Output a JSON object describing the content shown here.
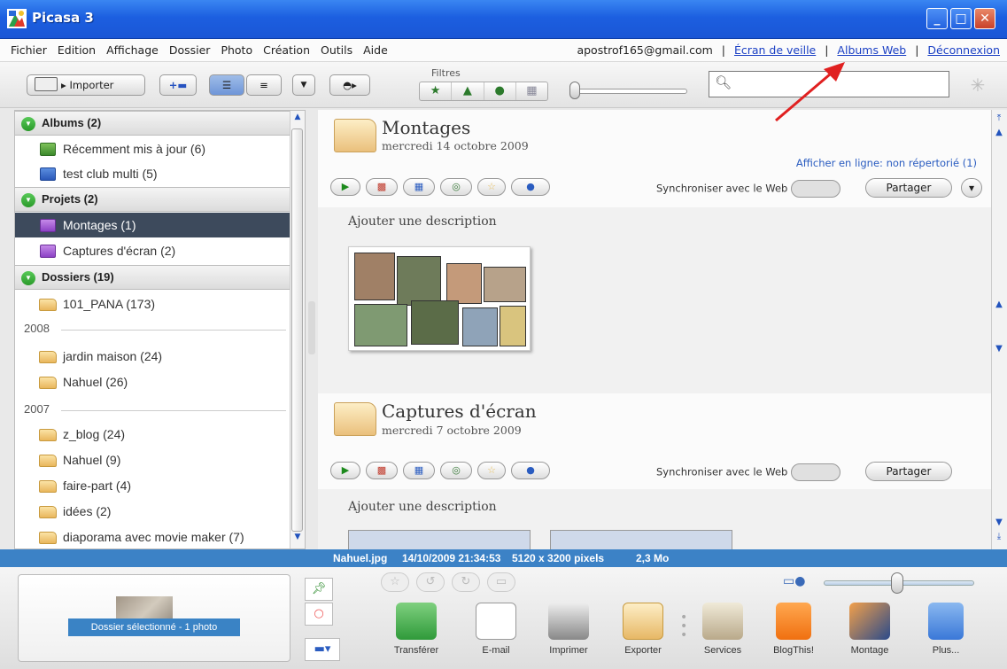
{
  "window": {
    "title": "Picasa 3",
    "controls": {
      "minimize": "_",
      "maximize": "□",
      "close": "✕"
    }
  },
  "menu": {
    "items": [
      "Fichier",
      "Edition",
      "Affichage",
      "Dossier",
      "Photo",
      "Création",
      "Outils",
      "Aide"
    ],
    "account": "apostrof165@gmail.com",
    "separator": "|",
    "links": {
      "screensaver": "Écran de veille",
      "web_albums": "Albums Web",
      "logout": "Déconnexion"
    }
  },
  "toolbar": {
    "import_label": "Importer",
    "filters_label": "Filtres",
    "filter_icons": [
      "star-icon",
      "upload-icon",
      "person-icon",
      "movie-icon"
    ],
    "search_placeholder": ""
  },
  "sidebar": {
    "sections": {
      "albums": {
        "label": "Albums (2)",
        "items": [
          "Récemment mis à jour (6)",
          "test club multi (5)"
        ]
      },
      "projects": {
        "label": "Projets (2)",
        "items": [
          "Montages (1)",
          "Captures d'écran (2)"
        ],
        "selected": "Montages (1)"
      },
      "folders": {
        "label": "Dossiers (19)",
        "items": [
          "101_PANA (173)"
        ]
      }
    },
    "years": [
      {
        "year": "2008",
        "items": [
          "jardin maison (24)",
          "Nahuel (26)"
        ]
      },
      {
        "year": "2007",
        "items": [
          "z_blog (24)",
          "Nahuel (9)",
          "faire-part (4)",
          "idées (2)",
          "diaporama avec movie maker (7)"
        ]
      }
    ]
  },
  "main": {
    "groups": [
      {
        "title": "Montages",
        "date": "mercredi 14 octobre 2009",
        "online_link": "Afficher en ligne: non répertorié (1)",
        "sync_label": "Synchroniser avec le Web",
        "share_label": "Partager",
        "description_placeholder": "Ajouter une description"
      },
      {
        "title": "Captures d'écran",
        "date": "mercredi 7 octobre 2009",
        "sync_label": "Synchroniser avec le Web",
        "share_label": "Partager",
        "description_placeholder": "Ajouter une description"
      }
    ]
  },
  "status": {
    "filename": "Nahuel.jpg",
    "datetime": "14/10/2009 21:34:53",
    "dimensions": "5120 x 3200 pixels",
    "size": "2,3 Mo"
  },
  "tray": {
    "selection_label": "Dossier sélectionné - 1 photo",
    "actions": [
      "Transférer",
      "E-mail",
      "Imprimer",
      "Exporter",
      "Services",
      "BlogThis!",
      "Montage",
      "Plus..."
    ]
  },
  "colors": {
    "titlebar": "#1c5fe0",
    "selection": "#3d4a5c",
    "status_bar": "#3c82c6",
    "link": "#1a3fc4",
    "annotation_arrow": "#e02020"
  }
}
